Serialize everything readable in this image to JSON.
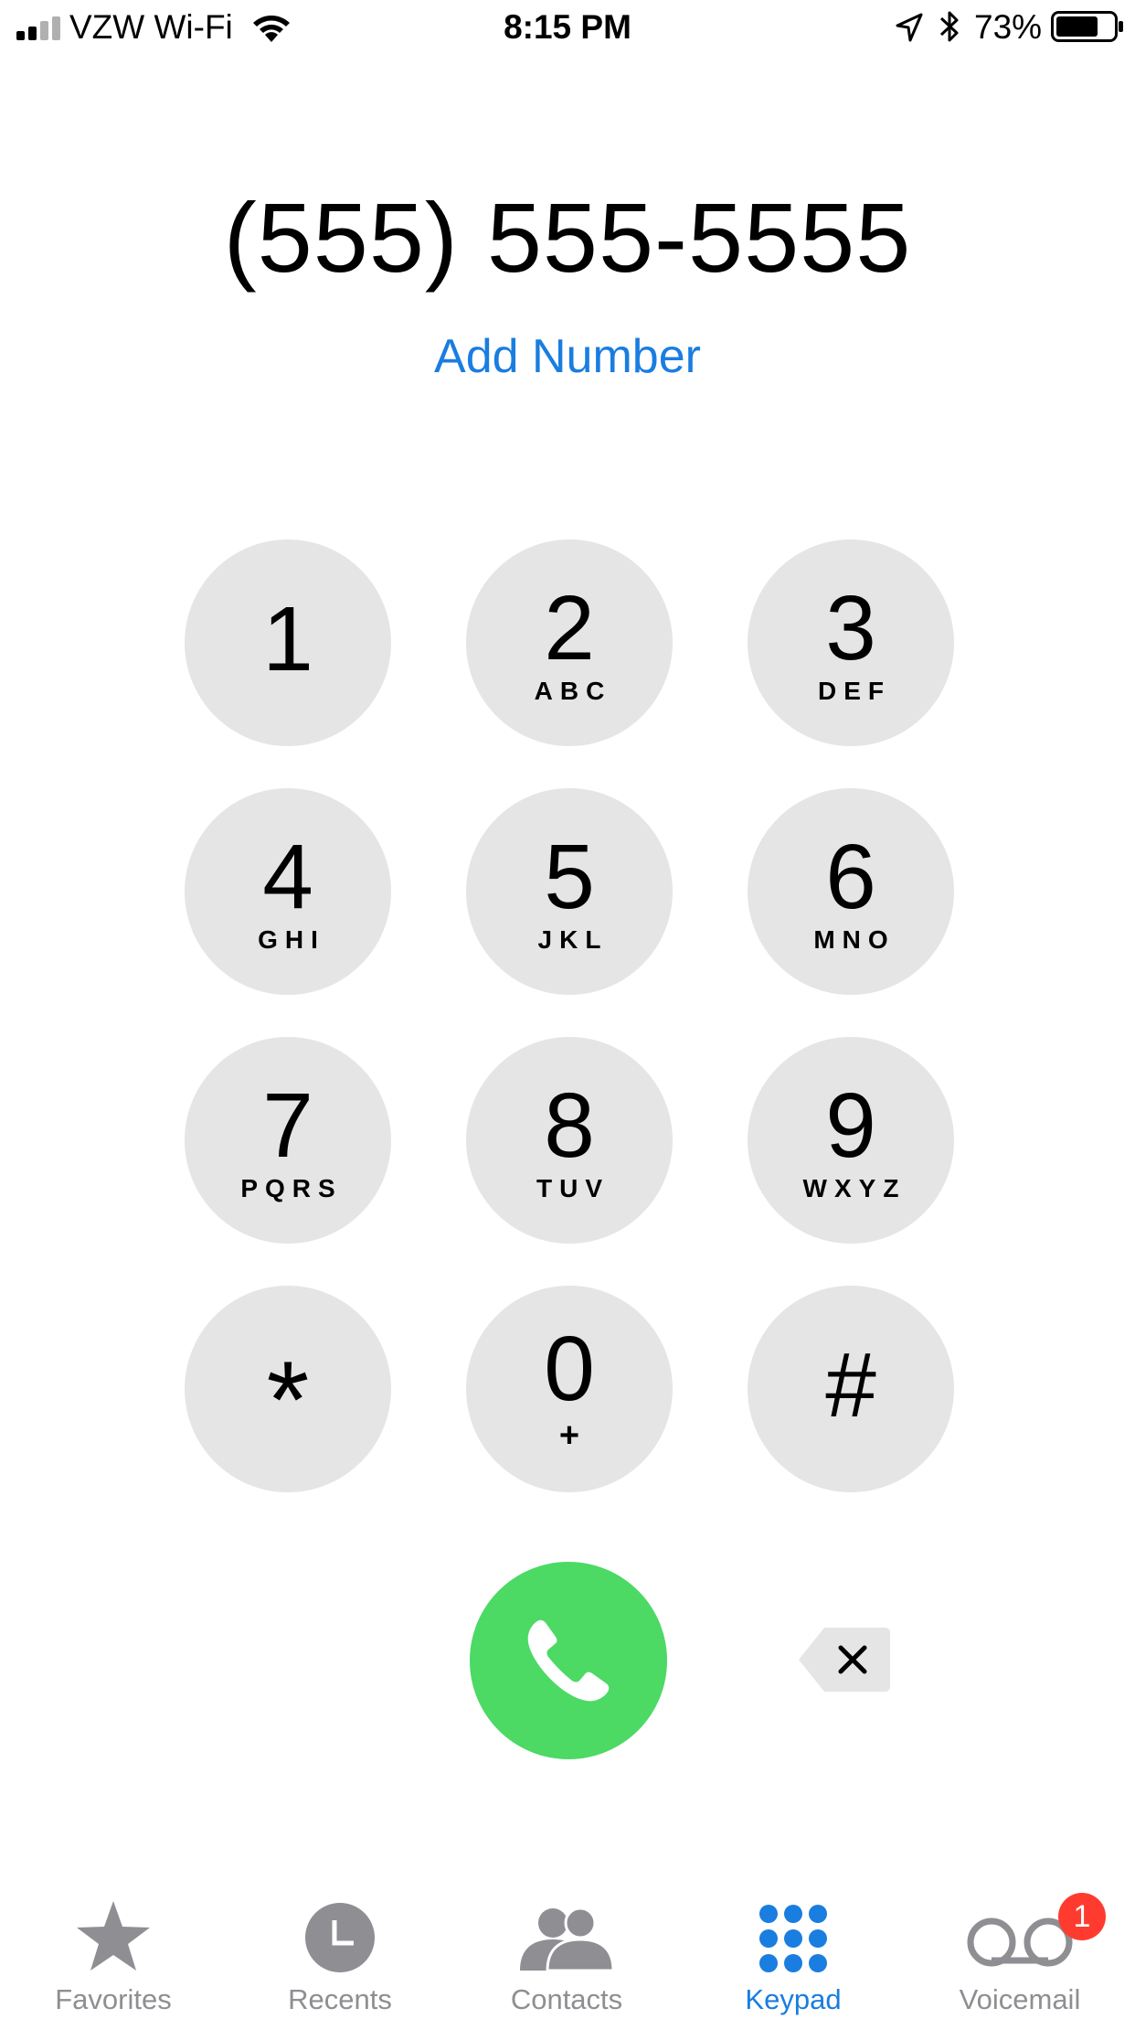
{
  "status_bar": {
    "carrier": "VZW Wi-Fi",
    "time": "8:15 PM",
    "battery_percent": "73%",
    "battery_level": 0.73,
    "icons": [
      "signal-icon",
      "wifi-icon",
      "location-icon",
      "bluetooth-icon",
      "battery-icon"
    ]
  },
  "dialer": {
    "number": "(555) 555-5555",
    "add_number": "Add Number"
  },
  "keypad": {
    "keys": [
      {
        "digit": "1",
        "letters": ""
      },
      {
        "digit": "2",
        "letters": "ABC"
      },
      {
        "digit": "3",
        "letters": "DEF"
      },
      {
        "digit": "4",
        "letters": "GHI"
      },
      {
        "digit": "5",
        "letters": "JKL"
      },
      {
        "digit": "6",
        "letters": "MNO"
      },
      {
        "digit": "7",
        "letters": "PQRS"
      },
      {
        "digit": "8",
        "letters": "TUV"
      },
      {
        "digit": "9",
        "letters": "WXYZ"
      },
      {
        "digit": "*",
        "letters": ""
      },
      {
        "digit": "0",
        "letters": "+"
      },
      {
        "digit": "#",
        "letters": ""
      }
    ],
    "call_icon": "phone-icon",
    "delete_icon": "backspace-icon"
  },
  "tabs": [
    {
      "label": "Favorites",
      "icon": "star-icon",
      "active": false
    },
    {
      "label": "Recents",
      "icon": "clock-icon",
      "active": false
    },
    {
      "label": "Contacts",
      "icon": "contacts-icon",
      "active": false
    },
    {
      "label": "Keypad",
      "icon": "keypad-icon",
      "active": true
    },
    {
      "label": "Voicemail",
      "icon": "voicemail-icon",
      "active": false,
      "badge": "1"
    }
  ],
  "colors": {
    "accent": "#1a7de0",
    "call_green": "#4cd964",
    "key_gray": "#e5e5e5",
    "tab_inactive": "#8e8e93",
    "badge_red": "#ff3b30"
  }
}
